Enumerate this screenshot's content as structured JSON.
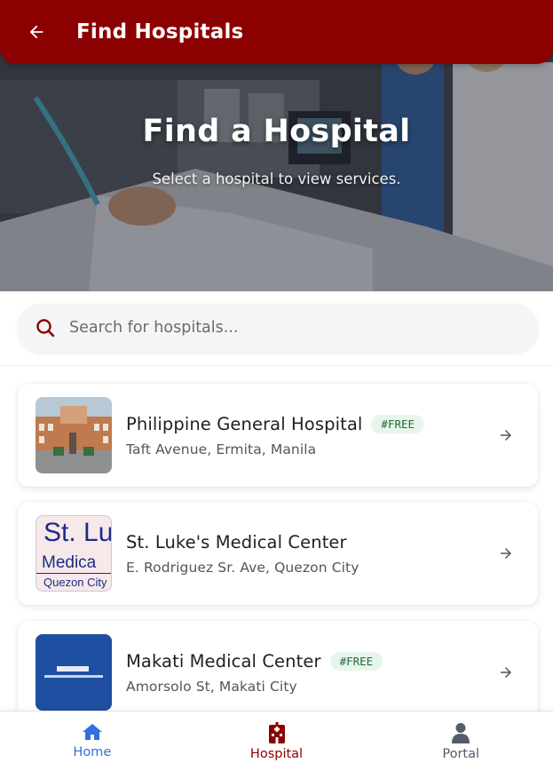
{
  "appbar": {
    "title": "Find Hospitals",
    "back_icon": "arrow-left-icon",
    "color": "#8b0000"
  },
  "hero": {
    "title": "Find a Hospital",
    "subtitle": "Select a hospital to view services."
  },
  "search": {
    "placeholder": "Search for hospitals...",
    "icon": "search-icon",
    "icon_color": "#8b0000"
  },
  "hospitals": [
    {
      "name": "Philippine General Hospital",
      "badge": "#FREE",
      "address": "Taft Avenue, Ermita, Manila"
    },
    {
      "name": "St. Luke's Medical Center",
      "badge": "",
      "address": "E. Rodriguez Sr. Ave, Quezon City",
      "logo_text": [
        "St. Lu",
        "Medica",
        "Quezon City"
      ]
    },
    {
      "name": "Makati Medical Center",
      "badge": "#FREE",
      "address": "Amorsolo St, Makati City"
    }
  ],
  "bottom_nav": [
    {
      "label": "Home",
      "icon": "home-icon",
      "color": "#2f6fde"
    },
    {
      "label": "Hospital",
      "icon": "hospital-icon",
      "color": "#8b0000",
      "active": true
    },
    {
      "label": "Portal",
      "icon": "person-icon",
      "color": "#555c6b"
    }
  ]
}
